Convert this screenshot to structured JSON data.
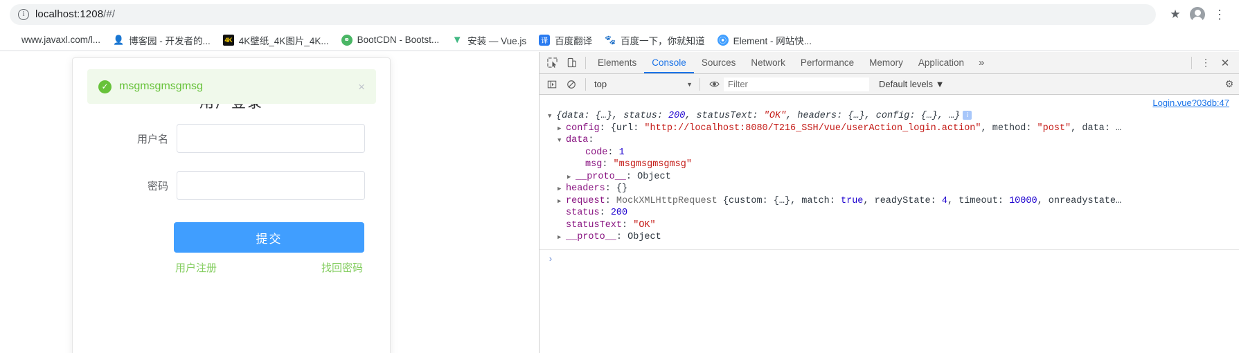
{
  "browser": {
    "omnibox": {
      "icon": "info-icon",
      "url_host": "localhost:1208",
      "url_path": "/#/"
    },
    "star_icon": "★",
    "profile_icon": "avatar",
    "menu_icon": "⋮",
    "bookmarks": [
      {
        "label": "www.javaxl.com/l...",
        "icon": ""
      },
      {
        "label": "博客园 - 开发者的...",
        "icon": "博"
      },
      {
        "label": "4K壁纸_4K图片_4K...",
        "icon": "4K"
      },
      {
        "label": "BootCDN - Bootst...",
        "icon": "S"
      },
      {
        "label": "安装 — Vue.js",
        "icon": "V"
      },
      {
        "label": "百度翻译",
        "icon": "译"
      },
      {
        "label": "百度一下，你就知道",
        "icon": "熊"
      },
      {
        "label": "Element - 网站快...",
        "icon": "E"
      }
    ]
  },
  "login": {
    "title": "用户登录",
    "alert": {
      "icon": "check-circle-icon",
      "message": "msgmsgmsgmsg",
      "close": "×",
      "bg_color": "#f0f9eb",
      "text_color": "#67c23a"
    },
    "fields": [
      {
        "label": "用户名",
        "value": "",
        "placeholder": ""
      },
      {
        "label": "密码",
        "value": "",
        "placeholder": ""
      }
    ],
    "submit_label": "提交",
    "links": [
      {
        "label": "用户注册"
      },
      {
        "label": "找回密码"
      }
    ],
    "accent_color": "#409eff",
    "link_color": "#85ce61"
  },
  "devtools": {
    "inspect_icon": "inspect-icon",
    "device_icon": "device-toolbar-icon",
    "tabs": [
      {
        "label": "Elements",
        "active": false
      },
      {
        "label": "Console",
        "active": true
      },
      {
        "label": "Sources",
        "active": false
      },
      {
        "label": "Network",
        "active": false
      },
      {
        "label": "Performance",
        "active": false
      },
      {
        "label": "Memory",
        "active": false
      },
      {
        "label": "Application",
        "active": false
      }
    ],
    "more_tabs": "»",
    "settings_icon": "⚙",
    "panel_menu_icon": "⋮",
    "close_icon": "✕",
    "filterbar": {
      "execute_icon": "execute-icon",
      "clear_icon": "clear-console-icon",
      "context": "top",
      "context_caret": "▼",
      "eye_icon": "live-expression-icon",
      "filter_placeholder": "Filter",
      "filter_value": "",
      "levels": "Default levels ▼"
    },
    "console": {
      "source_link": "Login.vue?03db:47",
      "lines": [
        {
          "indent": 0,
          "arrow": "▼",
          "italic": true,
          "tokens": [
            {
              "t": "{data: {…}, status: ",
              "c": "plain"
            },
            {
              "t": "200",
              "c": "num"
            },
            {
              "t": ", statusText: ",
              "c": "plain"
            },
            {
              "t": "\"OK\"",
              "c": "str"
            },
            {
              "t": ", headers: {…}, config: {…}, …}",
              "c": "plain"
            }
          ],
          "badge": "i"
        },
        {
          "indent": 1,
          "arrow": "▶",
          "italic": false,
          "tokens": [
            {
              "t": "config",
              "c": "name"
            },
            {
              "t": ": {url: ",
              "c": "plain"
            },
            {
              "t": "\"http://localhost:8080/T216_SSH/vue/userAction_login.action\"",
              "c": "str"
            },
            {
              "t": ", method: ",
              "c": "plain"
            },
            {
              "t": "\"post\"",
              "c": "str"
            },
            {
              "t": ", data: …",
              "c": "plain"
            }
          ]
        },
        {
          "indent": 1,
          "arrow": "▼",
          "italic": false,
          "tokens": [
            {
              "t": "data",
              "c": "name"
            },
            {
              "t": ":",
              "c": "plain"
            }
          ]
        },
        {
          "indent": 3,
          "arrow": "",
          "italic": false,
          "tokens": [
            {
              "t": "code",
              "c": "name"
            },
            {
              "t": ": ",
              "c": "plain"
            },
            {
              "t": "1",
              "c": "num"
            }
          ]
        },
        {
          "indent": 3,
          "arrow": "",
          "italic": false,
          "tokens": [
            {
              "t": "msg",
              "c": "name"
            },
            {
              "t": ": ",
              "c": "plain"
            },
            {
              "t": "\"msgmsgmsgmsg\"",
              "c": "str"
            }
          ]
        },
        {
          "indent": 2,
          "arrow": "▶",
          "italic": false,
          "tokens": [
            {
              "t": "__proto__",
              "c": "proto"
            },
            {
              "t": ": Object",
              "c": "plain"
            }
          ]
        },
        {
          "indent": 1,
          "arrow": "▶",
          "italic": false,
          "tokens": [
            {
              "t": "headers",
              "c": "name"
            },
            {
              "t": ": {}",
              "c": "plain"
            }
          ]
        },
        {
          "indent": 1,
          "arrow": "▶",
          "italic": false,
          "tokens": [
            {
              "t": "request",
              "c": "name"
            },
            {
              "t": ": ",
              "c": "plain"
            },
            {
              "t": "MockXMLHttpRequest ",
              "c": "cls"
            },
            {
              "t": "{custom: {…}, match: ",
              "c": "plain"
            },
            {
              "t": "true",
              "c": "bool"
            },
            {
              "t": ", readyState: ",
              "c": "plain"
            },
            {
              "t": "4",
              "c": "num"
            },
            {
              "t": ", timeout: ",
              "c": "plain"
            },
            {
              "t": "10000",
              "c": "num"
            },
            {
              "t": ", onreadystate…",
              "c": "plain"
            }
          ]
        },
        {
          "indent": 1,
          "arrow": "",
          "italic": false,
          "tokens": [
            {
              "t": "status",
              "c": "name"
            },
            {
              "t": ": ",
              "c": "plain"
            },
            {
              "t": "200",
              "c": "num"
            }
          ]
        },
        {
          "indent": 1,
          "arrow": "",
          "italic": false,
          "tokens": [
            {
              "t": "statusText",
              "c": "name"
            },
            {
              "t": ": ",
              "c": "plain"
            },
            {
              "t": "\"OK\"",
              "c": "str"
            }
          ]
        },
        {
          "indent": 1,
          "arrow": "▶",
          "italic": false,
          "tokens": [
            {
              "t": "__proto__",
              "c": "proto"
            },
            {
              "t": ": Object",
              "c": "plain"
            }
          ]
        }
      ],
      "prompt": "›"
    }
  }
}
